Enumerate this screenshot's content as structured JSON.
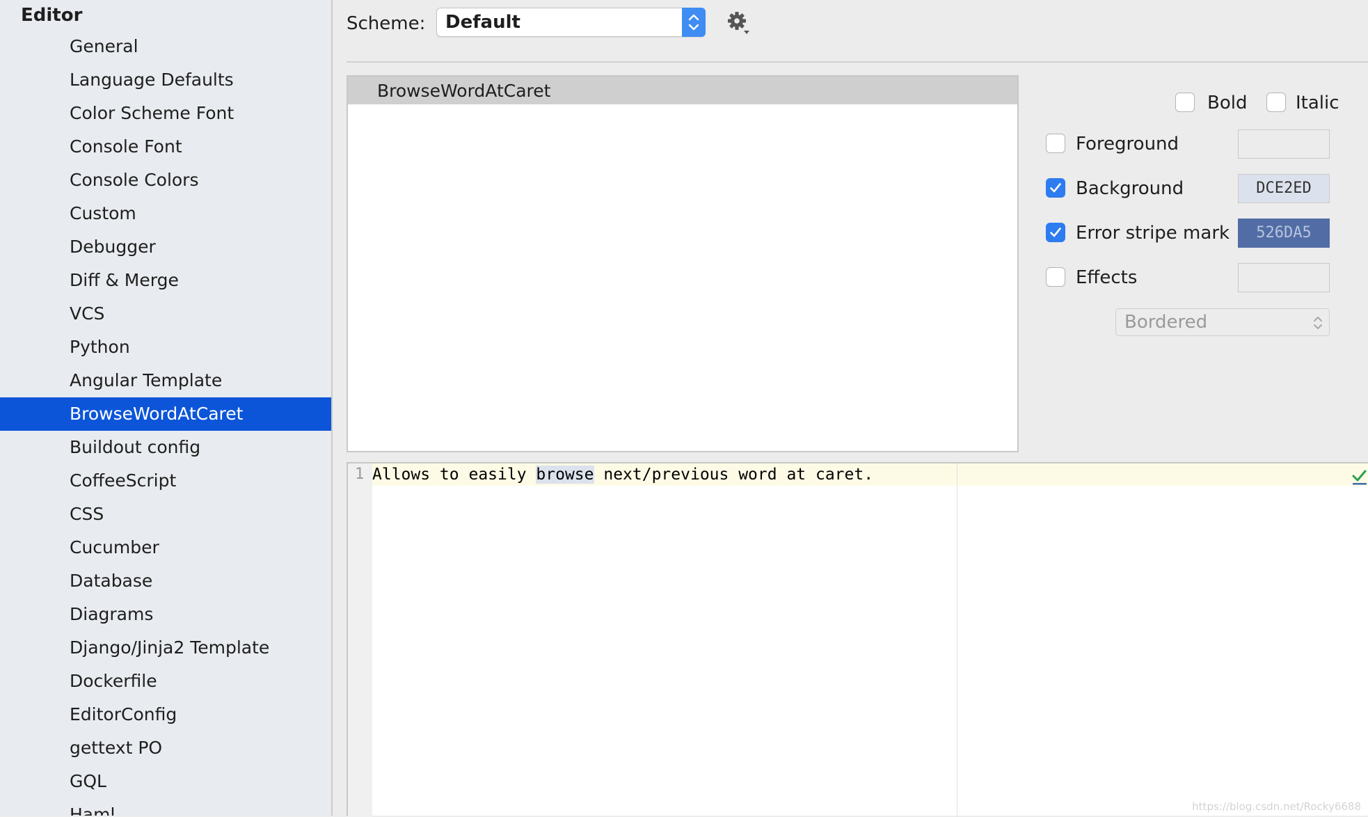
{
  "sidebar": {
    "header": "Editor",
    "items": [
      {
        "label": "General"
      },
      {
        "label": "Language Defaults"
      },
      {
        "label": "Color Scheme Font"
      },
      {
        "label": "Console Font"
      },
      {
        "label": "Console Colors"
      },
      {
        "label": "Custom"
      },
      {
        "label": "Debugger"
      },
      {
        "label": "Diff & Merge"
      },
      {
        "label": "VCS"
      },
      {
        "label": "Python"
      },
      {
        "label": "Angular Template"
      },
      {
        "label": "BrowseWordAtCaret",
        "selected": true
      },
      {
        "label": "Buildout config"
      },
      {
        "label": "CoffeeScript"
      },
      {
        "label": "CSS"
      },
      {
        "label": "Cucumber"
      },
      {
        "label": "Database"
      },
      {
        "label": "Diagrams"
      },
      {
        "label": "Django/Jinja2 Template"
      },
      {
        "label": "Dockerfile"
      },
      {
        "label": "EditorConfig"
      },
      {
        "label": "gettext PO"
      },
      {
        "label": "GQL"
      },
      {
        "label": "Haml"
      }
    ]
  },
  "scheme": {
    "label": "Scheme:",
    "value": "Default",
    "settings_icon": "gear-icon"
  },
  "attributes": {
    "items": [
      "BrowseWordAtCaret"
    ]
  },
  "options": {
    "bold": {
      "label": "Bold",
      "checked": false
    },
    "italic": {
      "label": "Italic",
      "checked": false
    },
    "foreground": {
      "label": "Foreground",
      "checked": false,
      "color": ""
    },
    "background": {
      "label": "Background",
      "checked": true,
      "color": "DCE2ED",
      "swatch_hex": "#dce2ed"
    },
    "error_stripe": {
      "label": "Error stripe mark",
      "checked": true,
      "color": "526DA5",
      "swatch_hex": "#526da5"
    },
    "effects": {
      "label": "Effects",
      "checked": false,
      "color": ""
    },
    "effect_type": "Bordered"
  },
  "preview": {
    "line_number": "1",
    "before": "Allows to easily ",
    "highlight": "browse",
    "after": " next/previous word at caret."
  },
  "watermark": "https://blog.csdn.net/Rocky6688",
  "colors": {
    "selection": "#0c55d9",
    "accent": "#2d7cf0"
  }
}
